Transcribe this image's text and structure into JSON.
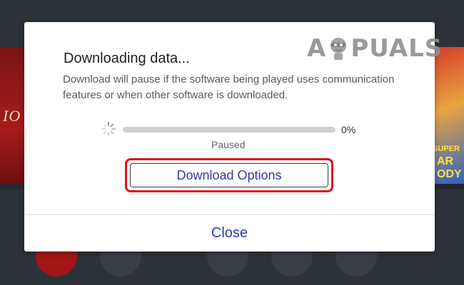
{
  "background": {
    "left_tile_text": "IO",
    "right_tile_text": "SUPER\nAR\nODY"
  },
  "dialog": {
    "title": "Downloading data...",
    "description": "Download will pause if the software being played uses communication features or when other software is downloaded.",
    "progress": {
      "value_percent": 0,
      "percent_label": "0%",
      "status": "Paused"
    },
    "download_options_label": "Download Options",
    "close_label": "Close"
  },
  "watermark": {
    "text_left": "A",
    "text_right": "PUALS"
  },
  "colors": {
    "accent_blue": "#2a3fa8",
    "highlight_red": "#d9101a",
    "backdrop": "#2d3238"
  }
}
